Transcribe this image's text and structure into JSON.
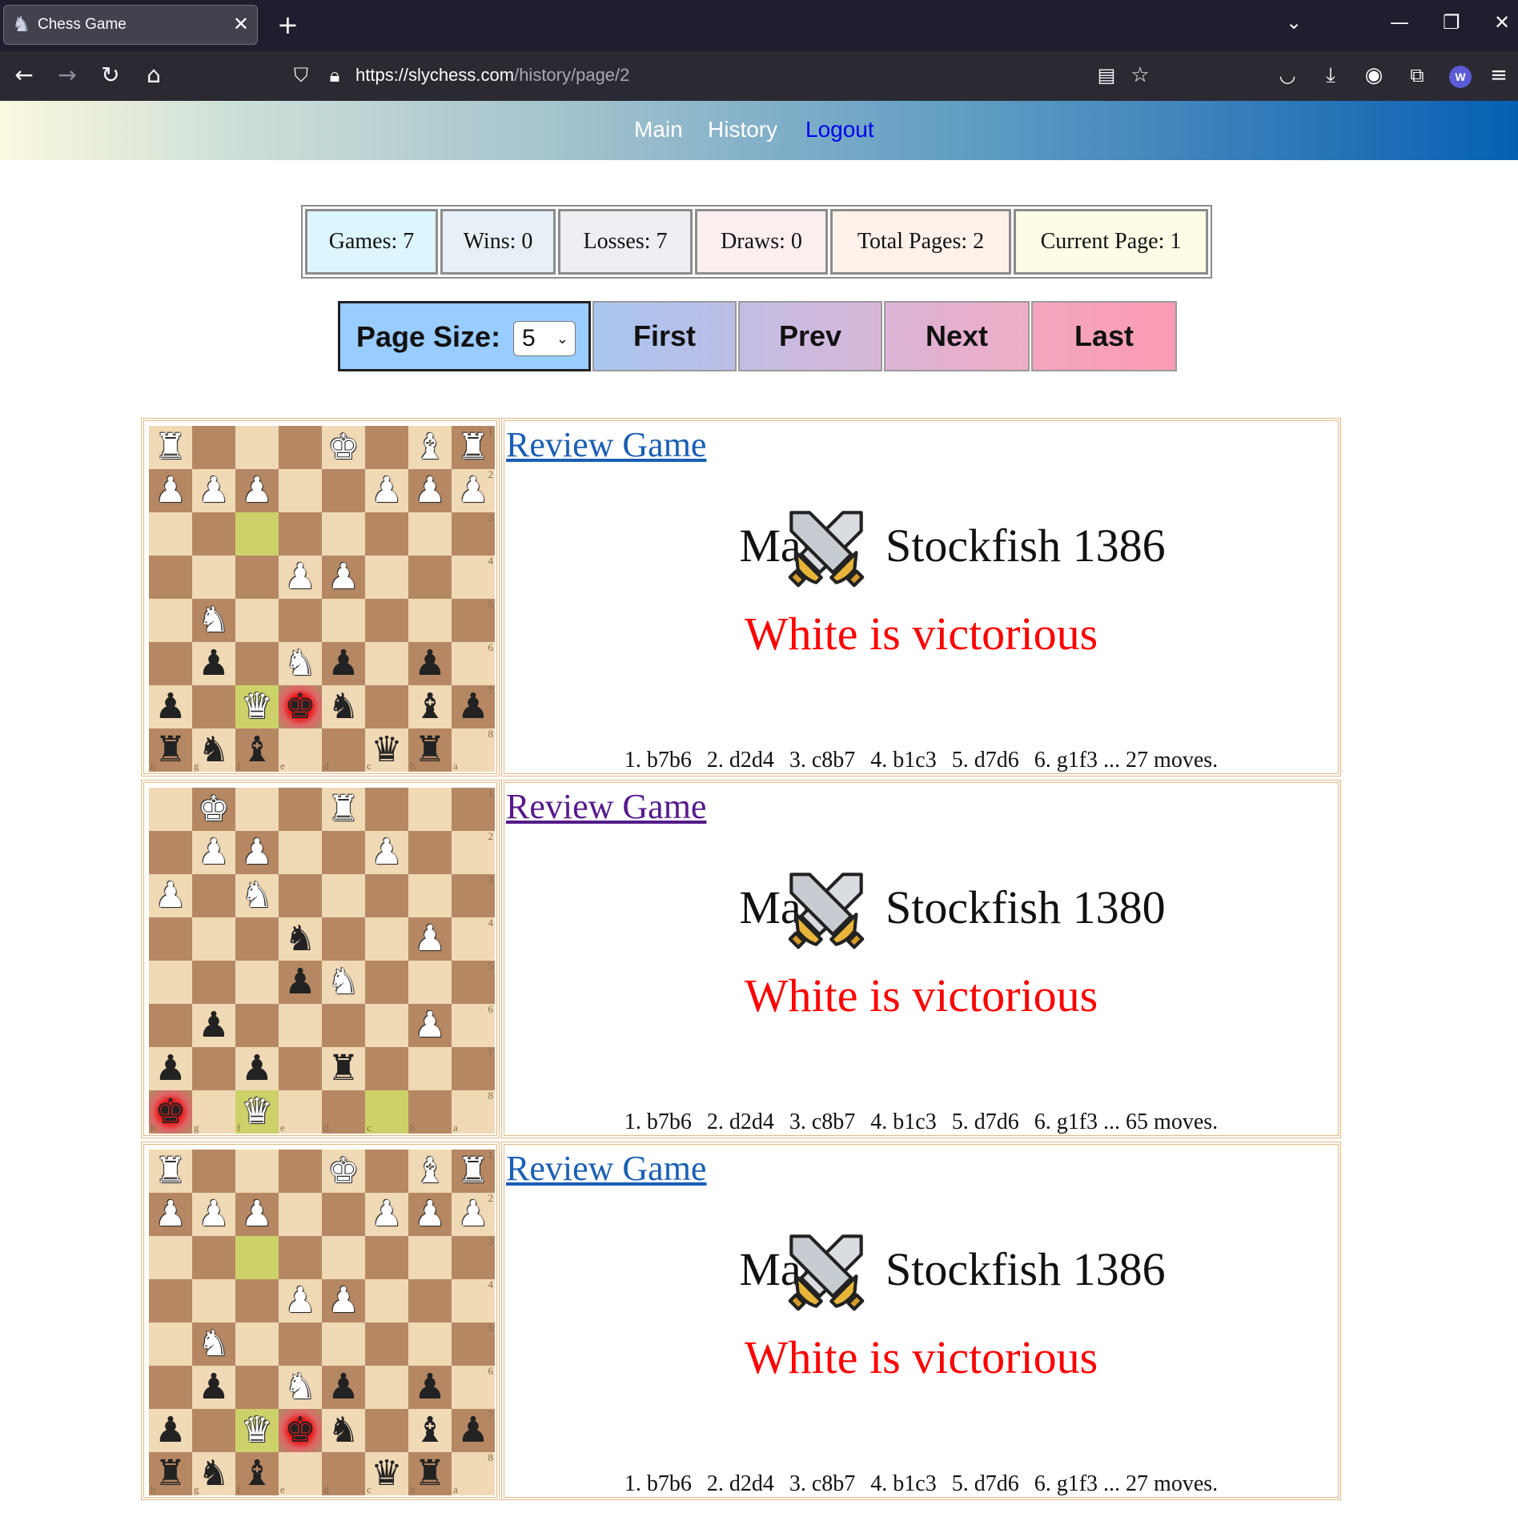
{
  "browser": {
    "tab_title": "Chess Game",
    "tab_close": "✕",
    "new_tab": "+",
    "url_host": "https://slychess.com",
    "url_path": "/history/page/2",
    "profile_initial": "W"
  },
  "site_nav": {
    "main": "Main",
    "history": "History",
    "logout": "Logout"
  },
  "colors": {
    "logout_link": "#0000ee",
    "result": "#ff0000",
    "link": "#1a5fb4",
    "visited_link": "#551a8b"
  },
  "stats": [
    {
      "label": "Games: 7",
      "bg": "#ddf6fe"
    },
    {
      "label": "Wins: 0",
      "bg": "#e6f0f6"
    },
    {
      "label": "Losses: 7",
      "bg": "#eeeef4"
    },
    {
      "label": "Draws: 0",
      "bg": "#fbeeee"
    },
    {
      "label": "Total Pages: 2",
      "bg": "#fdf1ea"
    },
    {
      "label": "Current Page: 1",
      "bg": "#fefbe6"
    }
  ],
  "pager": {
    "page_size_label": "Page Size:",
    "page_size_value": "5",
    "first": "First",
    "prev": "Prev",
    "next": "Next",
    "last": "Last"
  },
  "games": [
    {
      "review_label": "Review Game",
      "visited": false,
      "white": "Mary",
      "black": "Stockfish 1386",
      "result": "White is victorious",
      "moves": [
        "1. b7b6",
        "2. d2d4",
        "3. c8b7",
        "4. b1c3",
        "5. d7d6",
        "6. g1f3 ... 27 moves."
      ],
      "board": [
        "R...K.BR",
        "PPP..PPP",
        "........",
        "...PP...",
        ".N......",
        ".p.Np.p.",
        "p.Qkn.bp",
        "rnb..qr."
      ],
      "highlights": [
        "2-2",
        "6-2"
      ],
      "check": "6-3"
    },
    {
      "review_label": "Review Game",
      "visited": true,
      "white": "Mary",
      "black": "Stockfish 1380",
      "result": "White is victorious",
      "moves": [
        "1. b7b6",
        "2. d2d4",
        "3. c8b7",
        "4. b1c3",
        "5. d7d6",
        "6. g1f3 ... 65 moves."
      ],
      "board": [
        ".K..R...",
        ".PP..P..",
        "P.N.....",
        "...n..P.",
        "...pN...",
        ".p....P.",
        "p.p.r...",
        "k.Q....."
      ],
      "highlights": [
        "7-2",
        "7-5"
      ],
      "check": "7-0"
    },
    {
      "review_label": "Review Game",
      "visited": false,
      "white": "Mary",
      "black": "Stockfish 1386",
      "result": "White is victorious",
      "moves": [
        "1. b7b6",
        "2. d2d4",
        "3. c8b7",
        "4. b1c3",
        "5. d7d6",
        "6. g1f3 ... 27 moves."
      ],
      "board": [
        "R...K.BR",
        "PPP..PPP",
        "........",
        "...PP...",
        ".N......",
        ".p.Np.p.",
        "p.Qkn.bp",
        "rnb..qr."
      ],
      "highlights": [
        "2-2",
        "6-2"
      ],
      "check": "6-3"
    }
  ],
  "rank_labels": [
    "1",
    "2",
    "3",
    "4",
    "5",
    "6",
    "7",
    "8"
  ],
  "file_labels": [
    "h",
    "g",
    "f",
    "e",
    "d",
    "c",
    "b",
    "a"
  ]
}
